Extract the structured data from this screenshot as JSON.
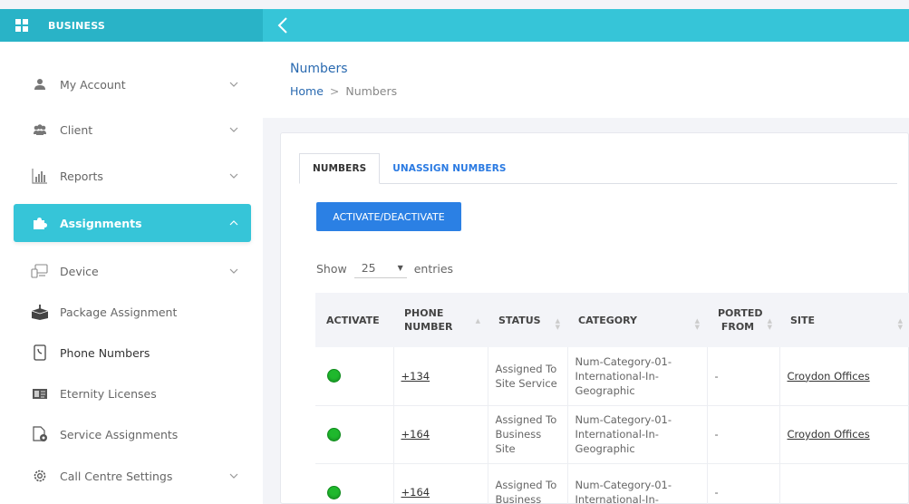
{
  "app": {
    "brand": "BUSINESS"
  },
  "sidebar": {
    "items": [
      {
        "label": "My Account",
        "icon": "user-icon"
      },
      {
        "label": "Client",
        "icon": "users-icon"
      },
      {
        "label": "Reports",
        "icon": "bar-chart-icon"
      },
      {
        "label": "Assignments",
        "icon": "puzzle-icon",
        "active": true
      },
      {
        "label": "Device",
        "icon": "device-icon"
      },
      {
        "label": "Package Assignment",
        "icon": "package-icon"
      },
      {
        "label": "Phone Numbers",
        "icon": "phone-book-icon",
        "current": true
      },
      {
        "label": "Eternity Licenses",
        "icon": "license-icon"
      },
      {
        "label": "Service Assignments",
        "icon": "file-gear-icon"
      },
      {
        "label": "Call Centre Settings",
        "icon": "gear-icon"
      }
    ]
  },
  "header": {
    "title": "Numbers",
    "breadcrumb": {
      "home": "Home",
      "separator": ">",
      "current": "Numbers"
    }
  },
  "tabs": [
    {
      "label": "NUMBERS",
      "active": true
    },
    {
      "label": "UNASSIGN NUMBERS",
      "active": false
    }
  ],
  "actions": {
    "activate_label": "ACTIVATE/DEACTIVATE"
  },
  "entries": {
    "show_label": "Show",
    "value": "25",
    "suffix": "entries"
  },
  "table": {
    "columns": [
      "ACTIVATE",
      "PHONE NUMBER",
      "STATUS",
      "CATEGORY",
      "PORTED FROM",
      "SITE"
    ],
    "rows": [
      {
        "active": true,
        "phone": "+134",
        "status": "Assigned To Site Service",
        "category": "Num-Category-01-International-In-Geographic",
        "ported": "-",
        "site": "Croydon Offices"
      },
      {
        "active": true,
        "phone": "+164",
        "status": "Assigned To Business Site",
        "category": "Num-Category-01-International-In-Geographic",
        "ported": "-",
        "site": "Croydon Offices"
      },
      {
        "active": true,
        "phone": "+164",
        "status": "Assigned To Business",
        "category": "Num-Category-01-International-In-",
        "ported": "-",
        "site": ""
      }
    ]
  },
  "colors": {
    "accent": "#36c5d8",
    "button": "#2b80e4",
    "link": "#2a6ab0",
    "status_active": "#1fb82d"
  }
}
